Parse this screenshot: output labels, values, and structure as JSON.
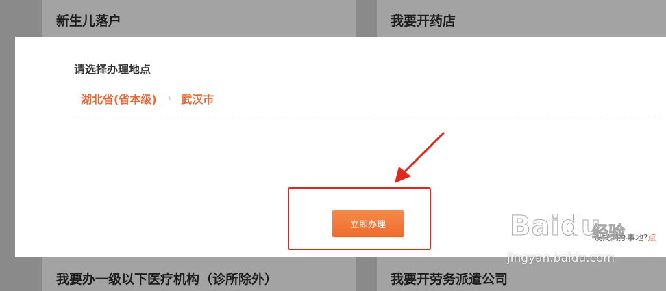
{
  "background": {
    "cards": [
      {
        "title": "新生儿落户"
      },
      {
        "title": "我要开药店"
      },
      {
        "title": "我要办一级以下医疗机构（诊所除外）"
      },
      {
        "title": "我要开劳务派遣公司"
      }
    ]
  },
  "modal": {
    "title": "请选择办理地点",
    "breadcrumb": {
      "province": "湖北省(省本级)",
      "separator": "›",
      "city": "武汉市"
    },
    "submit_label": "立即办理",
    "hint_prefix": "没找到办事地?",
    "hint_link": "点"
  },
  "watermark": {
    "brand": "Baidu",
    "sub": "经验",
    "url": "jingyan.baidu.com"
  },
  "colors": {
    "accent": "#e8693a",
    "annotation": "#e0281e"
  }
}
